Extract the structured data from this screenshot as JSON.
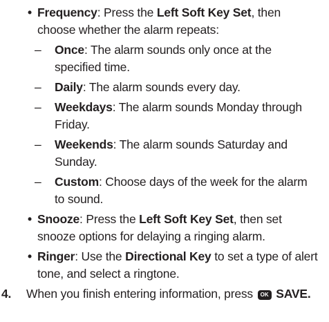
{
  "frequency": {
    "bullet": "•",
    "term": "Frequency",
    "sep": ": Press the ",
    "key": "Left Soft Key Set",
    "rest": ", then choose whether the alarm repeats:",
    "options": [
      {
        "dash": "–",
        "term": "Once",
        "desc": ": The alarm sounds only once at the specified time."
      },
      {
        "dash": "–",
        "term": "Daily",
        "desc": ": The alarm sounds every day."
      },
      {
        "dash": "–",
        "term": "Weekdays",
        "desc": ": The alarm sounds Monday through Friday."
      },
      {
        "dash": "–",
        "term": "Weekends",
        "desc": ": The alarm sounds Saturday and Sunday."
      },
      {
        "dash": "–",
        "term": "Custom",
        "desc": ": Choose days of the week for the alarm to sound."
      }
    ]
  },
  "snooze": {
    "bullet": "•",
    "term": "Snooze",
    "sep": ": Press the ",
    "key": "Left Soft Key Set",
    "rest": ", then set snooze options for delaying a ringing alarm."
  },
  "ringer": {
    "bullet": "•",
    "term": "Ringer",
    "sep": ": Use the ",
    "key": "Directional Key",
    "rest": " to set a type of alert tone, and select a ringtone."
  },
  "step4": {
    "number": "4.",
    "text": "When you finish entering information, press ",
    "ok_icon_label": "OK",
    "action": "SAVE",
    "end": "."
  }
}
